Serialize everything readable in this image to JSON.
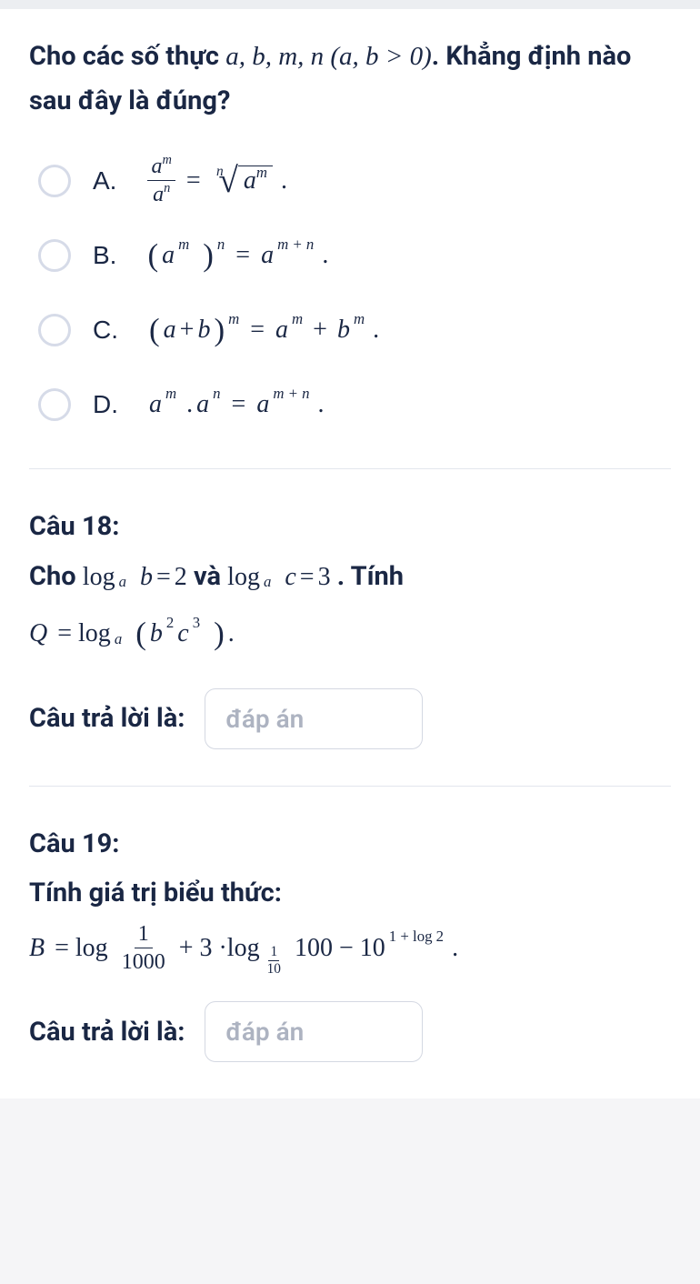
{
  "q17": {
    "stem_prefix": "Cho các số thực ",
    "stem_vars": "a, b, m, n (a, b > 0)",
    "stem_suffix": ". Khẳng định nào sau đây là ",
    "stem_bold": "đúng?",
    "options": {
      "A": {
        "label": "A."
      },
      "B": {
        "label": "B."
      },
      "C": {
        "label": "C."
      },
      "D": {
        "label": "D."
      }
    }
  },
  "q18": {
    "title": "Câu 18:",
    "body_prefix": "Cho ",
    "body_mid": " và ",
    "body_suffix": " . Tính",
    "logab_val": "2",
    "logac_val": "3",
    "answer_label": "Câu trả lời là:",
    "placeholder": "đáp án"
  },
  "q19": {
    "title": "Câu 19:",
    "body": "Tính giá trị biểu thức:",
    "answer_label": "Câu trả lời là:",
    "placeholder": "đáp án"
  }
}
